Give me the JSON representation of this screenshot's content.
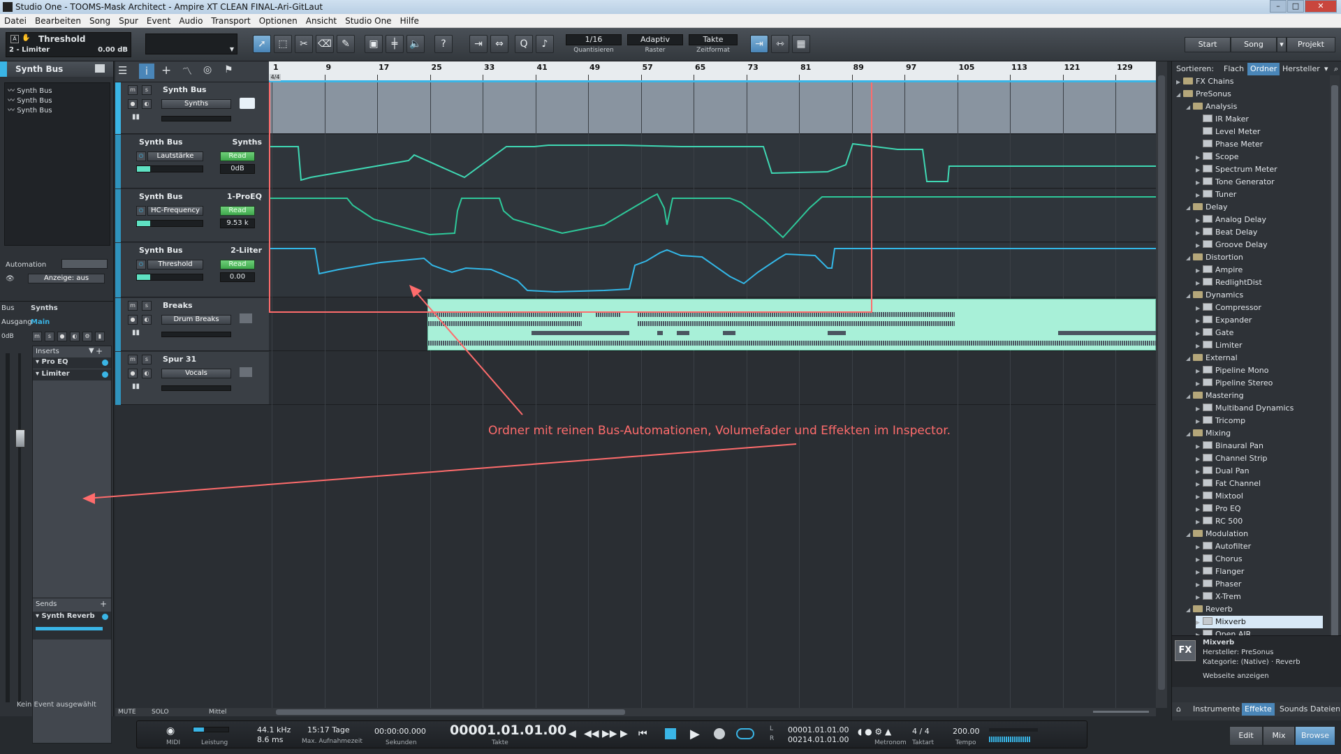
{
  "window": {
    "title": "Studio One - TOOMS-Mask Architect - Ampire XT CLEAN FINAL-Ari-GitLaut"
  },
  "menu": [
    "Datei",
    "Bearbeiten",
    "Song",
    "Spur",
    "Event",
    "Audio",
    "Transport",
    "Optionen",
    "Ansicht",
    "Studio One",
    "Hilfe"
  ],
  "toolbar": {
    "plugin_name": "Threshold",
    "plugin_sub": "2 - Limiter",
    "plugin_value": "0.00 dB",
    "quantize": "1/16",
    "quantize_label": "Quantisieren",
    "adaptive": "Adaptiv",
    "raster_label": "Raster",
    "timebase": "Takte",
    "timebase_label": "Zeitformat",
    "help": "?",
    "nav": [
      "Start",
      "Song",
      "Projekt"
    ]
  },
  "inspector": {
    "title": "Synth Bus",
    "list": [
      "Synth Bus",
      "Synth Bus",
      "Synth Bus"
    ],
    "automation_label": "Automation",
    "anzeige": "Anzeige: aus",
    "bus_label": "Bus",
    "bus_value": "Synths",
    "output_label": "Ausgang",
    "output_value": "Main",
    "db_label": "0dB",
    "inserts_label": "Inserts",
    "inserts": [
      "Pro EQ",
      "Limiter"
    ],
    "sends_label": "Sends",
    "sends": [
      "Synth Reverb"
    ],
    "no_event": "Kein Event ausgewählt"
  },
  "tracks": [
    {
      "name": "Synth Bus",
      "button": "Synths"
    },
    {
      "name": "Synth Bus",
      "target": "Synths",
      "param": "Lautstärke",
      "mode": "Read",
      "value": "0dB"
    },
    {
      "name": "Synth Bus",
      "target": "1-ProEQ",
      "param": "HC-Frequency",
      "mode": "Read",
      "value": "9.53 k"
    },
    {
      "name": "Synth Bus",
      "target": "2-Liiter",
      "param": "Threshold",
      "mode": "Read",
      "value": "0.00"
    },
    {
      "name": "Breaks",
      "button": "Drum Breaks"
    },
    {
      "name": "Spur 31",
      "button": "Vocals"
    }
  ],
  "ruler": [
    "1",
    "9",
    "17",
    "25",
    "33",
    "41",
    "49",
    "57",
    "65",
    "73",
    "81",
    "89",
    "97",
    "105",
    "113",
    "121",
    "129"
  ],
  "time_signature": "4/4",
  "annotation": "Ordner mit reinen Bus-Automationen, Volumefader und Effekten im Inspector.",
  "footer": {
    "mute": "MUTE",
    "solo": "SOLO",
    "mittel": "Mittel"
  },
  "transport": {
    "midi": "MIDI",
    "leistung": "Leistung",
    "samplerate": "44.1 kHz",
    "latency": "8.6 ms",
    "rec_time": "15:17 Tage",
    "rec_label": "Max. Aufnahmezeit",
    "seconds": "00:00:00.000",
    "seconds_label": "Sekunden",
    "bars": "00001.01.01.00",
    "bars_label": "Takte",
    "l_pos": "00001.01.01.00",
    "r_pos": "00214.01.01.00",
    "metronom": "Metronom",
    "sig": "4 / 4",
    "sig_label": "Taktart",
    "tempo": "200.00",
    "tempo_label": "Tempo"
  },
  "browser": {
    "sort_label": "Sortieren:",
    "tabs": [
      "Flach",
      "Ordner",
      "Hersteller"
    ],
    "tree": [
      {
        "label": "FX Chains",
        "level": 0,
        "kind": "folder",
        "arrow": "▶"
      },
      {
        "label": "PreSonus",
        "level": 0,
        "kind": "folder",
        "arrow": "◢"
      },
      {
        "label": "Analysis",
        "level": 1,
        "kind": "folder",
        "arrow": "◢"
      },
      {
        "label": "IR Maker",
        "level": 2,
        "kind": "item",
        "arrow": ""
      },
      {
        "label": "Level Meter",
        "level": 2,
        "kind": "item",
        "arrow": ""
      },
      {
        "label": "Phase Meter",
        "level": 2,
        "kind": "item",
        "arrow": ""
      },
      {
        "label": "Scope",
        "level": 2,
        "kind": "item",
        "arrow": "▶"
      },
      {
        "label": "Spectrum Meter",
        "level": 2,
        "kind": "item",
        "arrow": "▶"
      },
      {
        "label": "Tone Generator",
        "level": 2,
        "kind": "item",
        "arrow": "▶"
      },
      {
        "label": "Tuner",
        "level": 2,
        "kind": "item",
        "arrow": "▶"
      },
      {
        "label": "Delay",
        "level": 1,
        "kind": "folder",
        "arrow": "◢"
      },
      {
        "label": "Analog Delay",
        "level": 2,
        "kind": "item",
        "arrow": "▶"
      },
      {
        "label": "Beat Delay",
        "level": 2,
        "kind": "item",
        "arrow": "▶"
      },
      {
        "label": "Groove Delay",
        "level": 2,
        "kind": "item",
        "arrow": "▶"
      },
      {
        "label": "Distortion",
        "level": 1,
        "kind": "folder",
        "arrow": "◢"
      },
      {
        "label": "Ampire",
        "level": 2,
        "kind": "item",
        "arrow": "▶"
      },
      {
        "label": "RedlightDist",
        "level": 2,
        "kind": "item",
        "arrow": "▶"
      },
      {
        "label": "Dynamics",
        "level": 1,
        "kind": "folder",
        "arrow": "◢"
      },
      {
        "label": "Compressor",
        "level": 2,
        "kind": "item",
        "arrow": "▶"
      },
      {
        "label": "Expander",
        "level": 2,
        "kind": "item",
        "arrow": "▶"
      },
      {
        "label": "Gate",
        "level": 2,
        "kind": "item",
        "arrow": "▶"
      },
      {
        "label": "Limiter",
        "level": 2,
        "kind": "item",
        "arrow": "▶"
      },
      {
        "label": "External",
        "level": 1,
        "kind": "folder",
        "arrow": "◢"
      },
      {
        "label": "Pipeline Mono",
        "level": 2,
        "kind": "item",
        "arrow": "▶"
      },
      {
        "label": "Pipeline Stereo",
        "level": 2,
        "kind": "item",
        "arrow": "▶"
      },
      {
        "label": "Mastering",
        "level": 1,
        "kind": "folder",
        "arrow": "◢"
      },
      {
        "label": "Multiband Dynamics",
        "level": 2,
        "kind": "item",
        "arrow": "▶"
      },
      {
        "label": "Tricomp",
        "level": 2,
        "kind": "item",
        "arrow": "▶"
      },
      {
        "label": "Mixing",
        "level": 1,
        "kind": "folder",
        "arrow": "◢"
      },
      {
        "label": "Binaural Pan",
        "level": 2,
        "kind": "item",
        "arrow": "▶"
      },
      {
        "label": "Channel Strip",
        "level": 2,
        "kind": "item",
        "arrow": "▶"
      },
      {
        "label": "Dual Pan",
        "level": 2,
        "kind": "item",
        "arrow": "▶"
      },
      {
        "label": "Fat Channel",
        "level": 2,
        "kind": "item",
        "arrow": "▶"
      },
      {
        "label": "Mixtool",
        "level": 2,
        "kind": "item",
        "arrow": "▶"
      },
      {
        "label": "Pro EQ",
        "level": 2,
        "kind": "item",
        "arrow": "▶"
      },
      {
        "label": "RC 500",
        "level": 2,
        "kind": "item",
        "arrow": "▶"
      },
      {
        "label": "Modulation",
        "level": 1,
        "kind": "folder",
        "arrow": "◢"
      },
      {
        "label": "Autofilter",
        "level": 2,
        "kind": "item",
        "arrow": "▶"
      },
      {
        "label": "Chorus",
        "level": 2,
        "kind": "item",
        "arrow": "▶"
      },
      {
        "label": "Flanger",
        "level": 2,
        "kind": "item",
        "arrow": "▶"
      },
      {
        "label": "Phaser",
        "level": 2,
        "kind": "item",
        "arrow": "▶"
      },
      {
        "label": "X-Trem",
        "level": 2,
        "kind": "item",
        "arrow": "▶"
      },
      {
        "label": "Reverb",
        "level": 1,
        "kind": "folder",
        "arrow": "◢"
      },
      {
        "label": "Mixverb",
        "level": 2,
        "kind": "item",
        "arrow": "▶",
        "selected": true
      },
      {
        "label": "Open AIR",
        "level": 2,
        "kind": "item",
        "arrow": "▶"
      }
    ],
    "info": {
      "icon": "FX",
      "name": "Mixverb",
      "vendor": "Hersteller: PreSonus",
      "category": "Kategorie: (Native) · Reverb",
      "link": "Webseite anzeigen"
    },
    "bottom_tabs": [
      "Instrumente",
      "Effekte",
      "Sounds",
      "Dateien"
    ],
    "views": [
      "Edit",
      "Mix",
      "Browse"
    ]
  },
  "colors": {
    "accent": "#3ab5e6",
    "auto1": "#3fd9b4",
    "auto2": "#2ec99a",
    "auto3": "#33b8e8",
    "annotation": "#ff6c6c",
    "drum": "#a8f0d8"
  }
}
